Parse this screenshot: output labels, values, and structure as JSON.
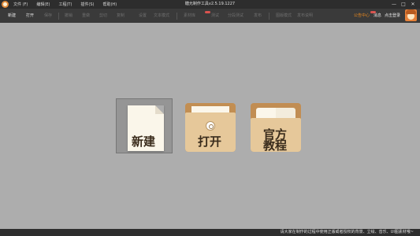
{
  "app": {
    "title": "糖允制作工具v2.5.19.1227",
    "menu": [
      "文件 (F)",
      "编辑(E)",
      "工程(T)",
      "插件(S)",
      "帮助(H)"
    ]
  },
  "window_controls": {
    "minimize": "—",
    "maximize": "□",
    "close": "✕"
  },
  "toolbar": {
    "new": "新建",
    "open": "打开",
    "save": "保存",
    "undo": "撤销",
    "redo": "重做",
    "cut": "剪切",
    "copy": "复制",
    "settings": "设置",
    "text_mode": "文本模式",
    "assets": "素材库",
    "test": "测试",
    "publish_test": "分段测试",
    "publish": "发布",
    "release_mode": "图版模式",
    "release": "发布说明"
  },
  "account": {
    "notice": "公告中心",
    "messages": "消息",
    "login": "点击登录"
  },
  "colors": {
    "accent": "#e8891e",
    "badge": "#d9534f",
    "folder": "#c28e52",
    "paper": "#faf6ea"
  },
  "home": {
    "tiles": [
      {
        "label": "新建",
        "icon": "new-doc-icon",
        "selected": true
      },
      {
        "label": "打开",
        "icon": "folder-icon",
        "selected": false
      },
      {
        "label_line1": "官方",
        "label_line2": "教程",
        "icon": "book-icon",
        "selected": false
      }
    ]
  },
  "status": {
    "tip": "请大家在制作的过程中使用正版或者授权的背景、立绘、音乐、UI图素材哦~"
  }
}
